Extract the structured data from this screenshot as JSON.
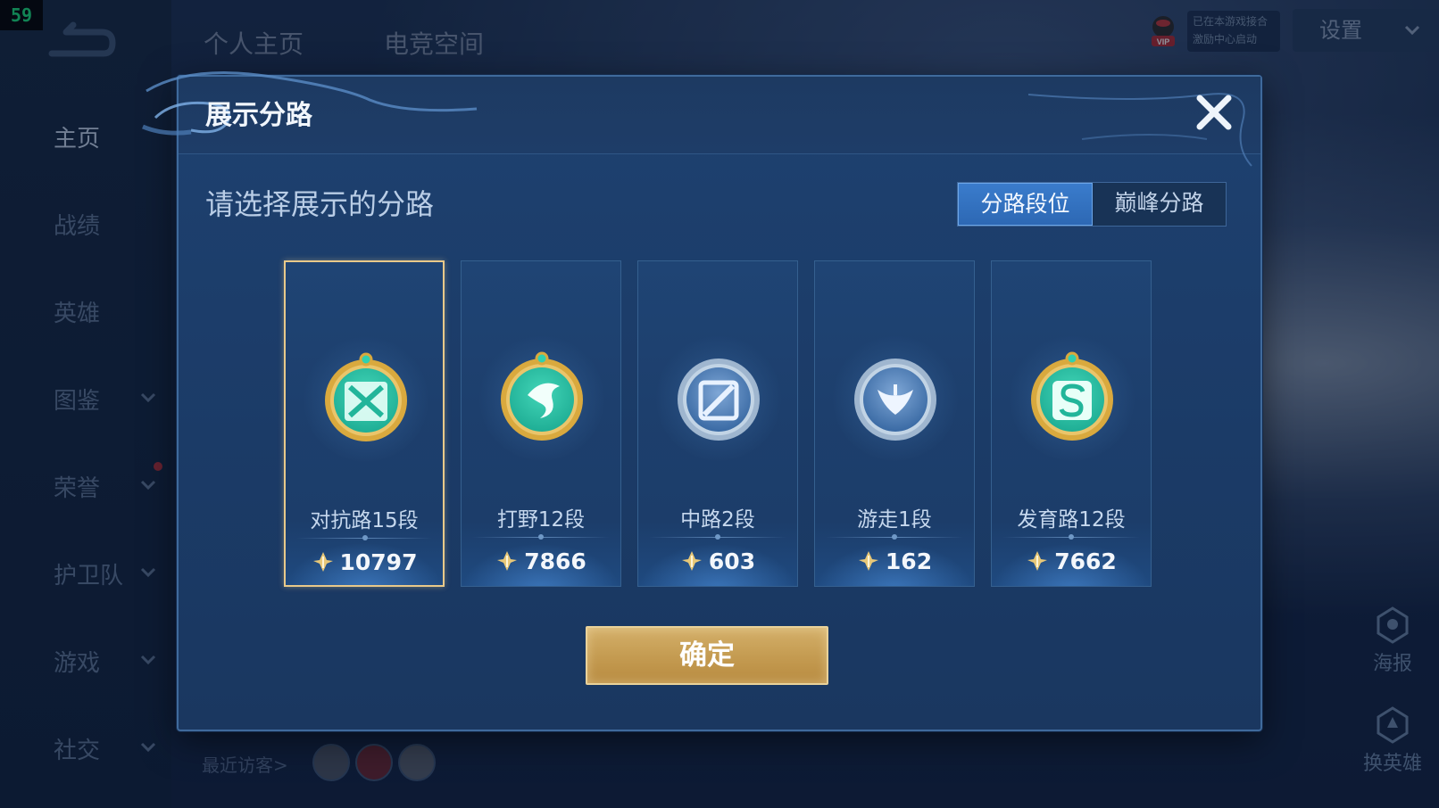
{
  "fps": "59",
  "top_tabs": [
    "个人主页",
    "电竞空间"
  ],
  "vip_box": [
    "已在本游戏接合",
    "激励中心启动"
  ],
  "settings_label": "设置",
  "sidebar": {
    "items": [
      {
        "label": "主页",
        "active": true
      },
      {
        "label": "战绩"
      },
      {
        "label": "英雄"
      },
      {
        "label": "图鉴",
        "chevron": true
      },
      {
        "label": "荣誉",
        "chevron": true
      },
      {
        "label": "护卫队",
        "chevron": true
      },
      {
        "label": "游戏",
        "chevron": true
      },
      {
        "label": "社交",
        "chevron": true
      }
    ]
  },
  "visitors_label": "最近访客>",
  "right_actions": [
    {
      "label": "海报",
      "icon": "poster-icon"
    },
    {
      "label": "换英雄",
      "icon": "swap-hero-icon"
    }
  ],
  "dialog": {
    "title": "展示分路",
    "prompt": "请选择展示的分路",
    "segment": {
      "options": [
        "分路段位",
        "巅峰分路"
      ],
      "selected": 0
    },
    "lanes": [
      {
        "name": "对抗路15段",
        "score": "10797",
        "icon": "clash-lane-emblem",
        "tier": "gold",
        "selected": true
      },
      {
        "name": "打野12段",
        "score": "7866",
        "icon": "jungle-dragon-emblem",
        "tier": "gold"
      },
      {
        "name": "中路2段",
        "score": "603",
        "icon": "mid-lane-emblem",
        "tier": "silver"
      },
      {
        "name": "游走1段",
        "score": "162",
        "icon": "roam-wings-emblem",
        "tier": "silver"
      },
      {
        "name": "发育路12段",
        "score": "7662",
        "icon": "farm-lane-emblem",
        "tier": "gold"
      }
    ],
    "confirm_label": "确定"
  },
  "colors": {
    "accent": "#2d68b4",
    "gold": "#c59c52",
    "selected_border": "#e8c98a"
  }
}
